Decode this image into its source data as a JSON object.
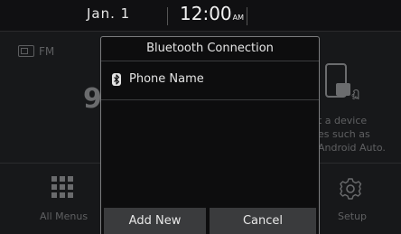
{
  "status_bar": {
    "date": "Jan.  1",
    "time": "12:00",
    "ampm": "AM"
  },
  "home": {
    "radio_label": "FM",
    "frequency_partial": "9",
    "hint_lines": [
      "t a device",
      "es such as",
      "Android Auto."
    ],
    "all_menus_label": "All Menus",
    "setup_label": "Setup"
  },
  "dialog": {
    "title": "Bluetooth Connection",
    "devices": [
      {
        "name": "Phone Name"
      }
    ],
    "add_new_label": "Add New",
    "cancel_label": "Cancel"
  },
  "icons": {
    "radio": "radio-icon",
    "bluetooth": "bluetooth-icon",
    "phone": "phone-icon",
    "usb": "usb-icon",
    "grid": "grid-icon",
    "gear": "gear-icon"
  },
  "colors": {
    "background": "#0b0b0c",
    "dialog_border": "#7a7b7d",
    "button_bg": "#3a3b3d",
    "text": "#e6e6e6",
    "dim_text": "#5f6062"
  }
}
